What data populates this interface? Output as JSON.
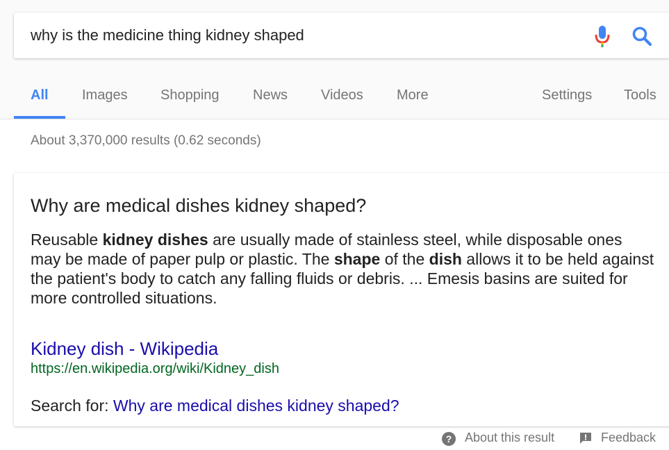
{
  "search": {
    "query": "why is the medicine thing kidney shaped"
  },
  "icons": {
    "mic": "microphone-icon",
    "search": "search-icon",
    "help": "help-circle-icon",
    "feedback": "feedback-icon"
  },
  "colors": {
    "accent": "#4285f4",
    "link": "#1a0dab",
    "url": "#006621",
    "muted": "#757575"
  },
  "tabs": [
    {
      "label": "All",
      "active": true
    },
    {
      "label": "Images"
    },
    {
      "label": "Shopping"
    },
    {
      "label": "News"
    },
    {
      "label": "Videos"
    },
    {
      "label": "More"
    },
    {
      "label": "Settings"
    },
    {
      "label": "Tools"
    }
  ],
  "stats": "About 3,370,000 results (0.62 seconds)",
  "featured": {
    "question": "Why are medical dishes kidney shaped?",
    "snippet_parts": [
      {
        "text": "Reusable ",
        "bold": false
      },
      {
        "text": "kidney dishes",
        "bold": true
      },
      {
        "text": " are usually made of stainless steel, while disposable ones may be made of paper pulp or plastic. The ",
        "bold": false
      },
      {
        "text": "shape",
        "bold": true
      },
      {
        "text": " of the ",
        "bold": false
      },
      {
        "text": "dish",
        "bold": true
      },
      {
        "text": " allows it to be held against the patient's body to catch any falling fluids or debris. ... Emesis basins are suited for more controlled situations.",
        "bold": false
      }
    ],
    "result_title": "Kidney dish - Wikipedia",
    "result_url": "https://en.wikipedia.org/wiki/Kidney_dish",
    "search_for_label": "Search for:",
    "search_for_link": "Why are medical dishes kidney shaped?"
  },
  "footer": {
    "about": "About this result",
    "feedback": "Feedback"
  }
}
